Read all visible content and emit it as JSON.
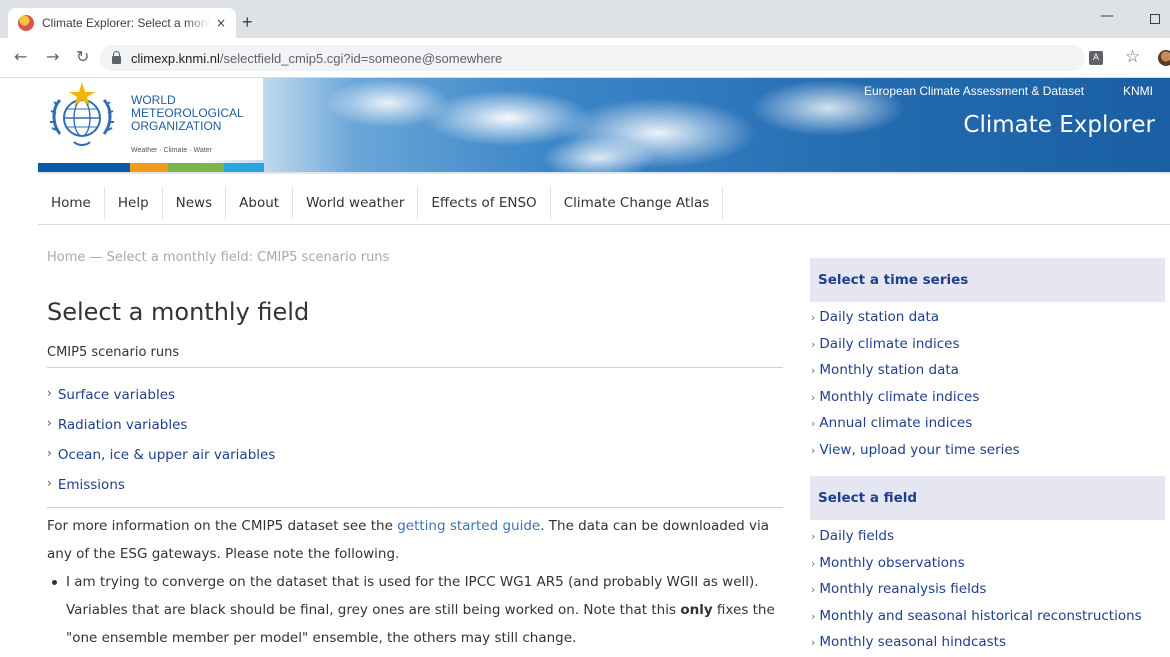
{
  "browser": {
    "tab_title": "Climate Explorer: Select a monthly field",
    "tab_close": "×",
    "new_tab": "+",
    "url_host": "climexp.knmi.nl",
    "url_path": "/selectfield_cmip5.cgi?id=someone@somewhere",
    "icons": [
      "back-icon",
      "forward-icon",
      "reload-icon",
      "lock-icon",
      "translate-icon",
      "star-icon",
      "profile-avatar"
    ]
  },
  "header": {
    "org_line1": "WORLD",
    "org_line2": "METEOROLOGICAL",
    "org_line3": "ORGANIZATION",
    "tagline": "Weather · Climate · Water",
    "eca_link": "European Climate Assessment & Dataset",
    "knmi_link": "KNMI",
    "site_title": "Climate Explorer",
    "colors": {
      "wmo_blue": "#1f5ca6",
      "bar_blue": "#0b5aa7",
      "bar_orange": "#f29a1e",
      "bar_green": "#7ab648",
      "bar_cyan": "#2aa6df"
    }
  },
  "nav": {
    "items": [
      "Home",
      "Help",
      "News",
      "About",
      "World weather",
      "Effects of ENSO",
      "Climate Change Atlas"
    ]
  },
  "main": {
    "breadcrumb": "Home — Select a monthly field: CMIP5 scenario runs",
    "title": "Select a monthly field",
    "subtitle": "CMIP5 scenario runs",
    "variables": [
      "Surface variables",
      "Radiation variables",
      "Ocean, ice & upper air variables",
      "Emissions"
    ],
    "para_before": "For more information on the CMIP5 dataset see the ",
    "para_link": "getting started guide",
    "para_after": ". The data can be downloaded via any of the ESG gateways. Please note the following.",
    "bullet1_a": "I am trying to converge on the dataset that is used for the IPCC WG1 AR5 (and probably WGII as well). Variables that are black should be final, grey ones are still being worked on. Note that this ",
    "bullet1_bold": "only",
    "bullet1_b": " fixes the \"one ensemble member per model\" ensemble, the others may still change."
  },
  "sidebar": {
    "timeseries_heading": "Select a time series",
    "timeseries_items": [
      "Daily station data",
      "Daily climate indices",
      "Monthly station data",
      "Monthly climate indices",
      "Annual climate indices",
      "View, upload your time series"
    ],
    "field_heading": "Select a field",
    "field_items": [
      "Daily fields",
      "Monthly observations",
      "Monthly reanalysis fields",
      "Monthly and seasonal historical reconstructions",
      "Monthly seasonal hindcasts"
    ]
  }
}
